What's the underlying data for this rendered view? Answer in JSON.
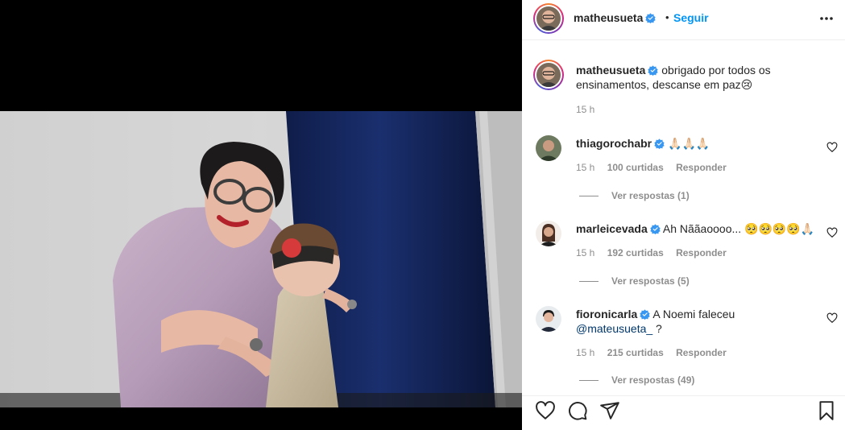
{
  "header": {
    "username": "matheusueta",
    "dot": "•",
    "follow_label": "Seguir"
  },
  "caption": {
    "username": "matheusueta",
    "text": "obrigado por todos os ensinamentos, descanse em paz😢",
    "time": "15 h"
  },
  "comments": [
    {
      "username": "thiagorochabr",
      "text": "🙏🏻🙏🏻🙏🏻",
      "time": "15 h",
      "likes": "100 curtidas",
      "reply_label": "Responder",
      "view_replies": "Ver respostas (1)"
    },
    {
      "username": "marleicevada",
      "text": "Ah Nããaoooo... 🥺🥺🥺🥺🙏🏻",
      "time": "15 h",
      "likes": "192 curtidas",
      "reply_label": "Responder",
      "view_replies": "Ver respostas (5)"
    },
    {
      "username": "fioronicarla",
      "text": "A Noemi faleceu",
      "mention": "@mateusueta_",
      "text_after": " ?",
      "time": "15 h",
      "likes": "215 curtidas",
      "reply_label": "Responder",
      "view_replies": "Ver respostas (49)"
    }
  ],
  "colors": {
    "follow": "#0095f6",
    "verified": "#3897f0",
    "muted": "#8e8e8e",
    "text": "#262626"
  },
  "icons": [
    "verified-badge-icon",
    "more-options-icon",
    "heart-icon",
    "comment-icon",
    "share-icon",
    "bookmark-icon"
  ]
}
